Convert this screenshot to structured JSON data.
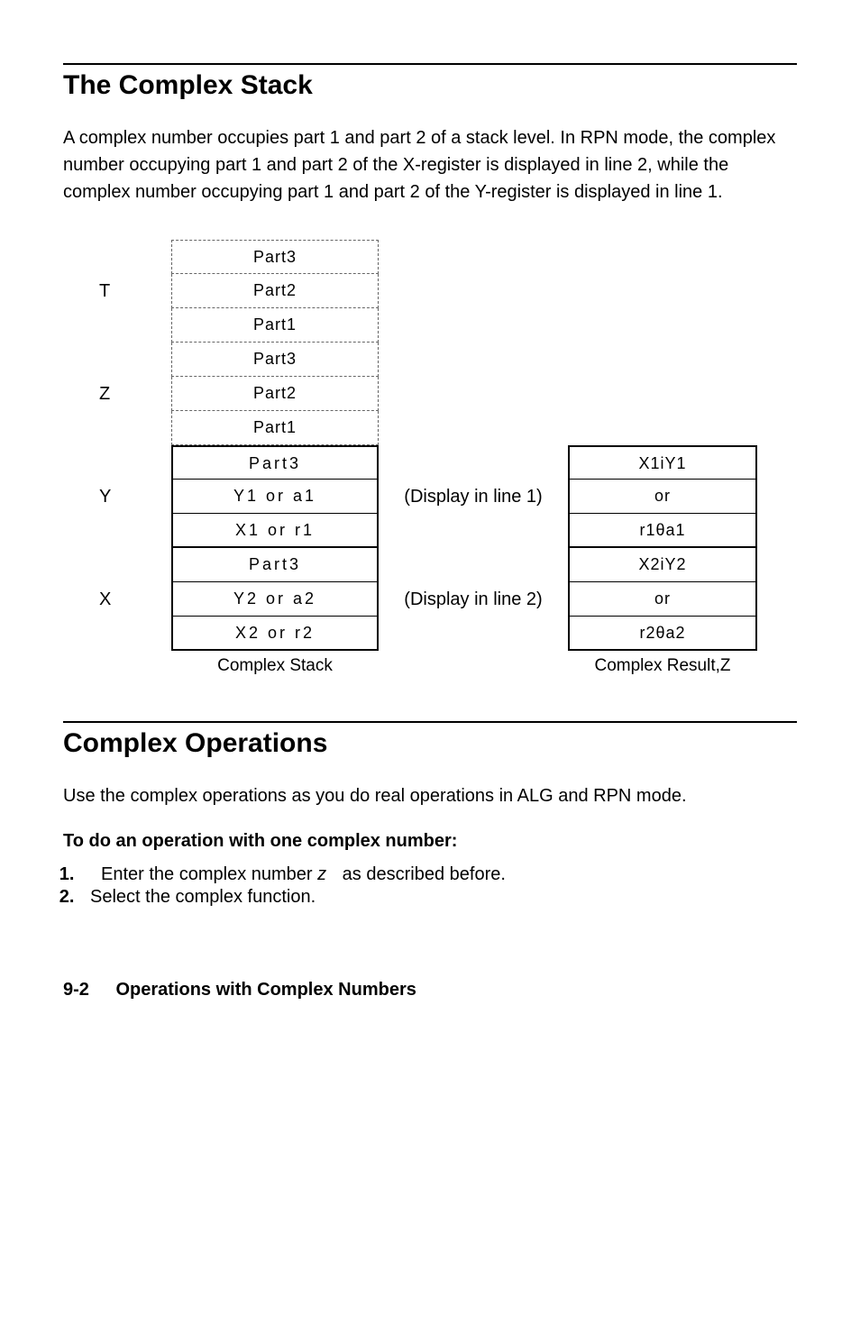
{
  "section1": {
    "title": "The Complex Stack",
    "paragraph": "A complex number occupies part 1 and part 2 of a stack level. In RPN mode, the complex number occupying part 1 and part 2 of the X-register is displayed in line 2, while the complex number occupying part 1 and part 2 of the Y-register is displayed in line 1."
  },
  "diagram": {
    "registers": {
      "T": {
        "label": "T",
        "p3": "Part3",
        "p2": "Part2",
        "p1": "Part1"
      },
      "Z": {
        "label": "Z",
        "p3": "Part3",
        "p2": "Part2",
        "p1": "Part1"
      },
      "Y": {
        "label": "Y",
        "p3": "Part3",
        "p2": "Y1 or a1",
        "p1": "X1 or r1",
        "note": "(Display in line 1)",
        "r3": "X1iY1",
        "r2": "or",
        "r1": "r1θa1"
      },
      "X": {
        "label": "X",
        "p3": "Part3",
        "p2": "Y2 or a2",
        "p1": "X2 or r2",
        "note": "(Display in line 2)",
        "r3": "X2iY2",
        "r2": "or",
        "r1": "r2θa2"
      }
    },
    "stack_caption": "Complex Stack",
    "result_caption": "Complex Result,Z"
  },
  "section2": {
    "title": "Complex Operations",
    "paragraph": "Use the complex operations as you do real operations in ALG and RPN mode.",
    "subhead": "To do an operation with one complex number:",
    "step1_a": "Enter the complex number ",
    "step1_z": "z",
    "step1_b": " as described before.",
    "step2": "Select the complex function."
  },
  "footer": {
    "page": "9-2",
    "title": "Operations with Complex Numbers"
  }
}
